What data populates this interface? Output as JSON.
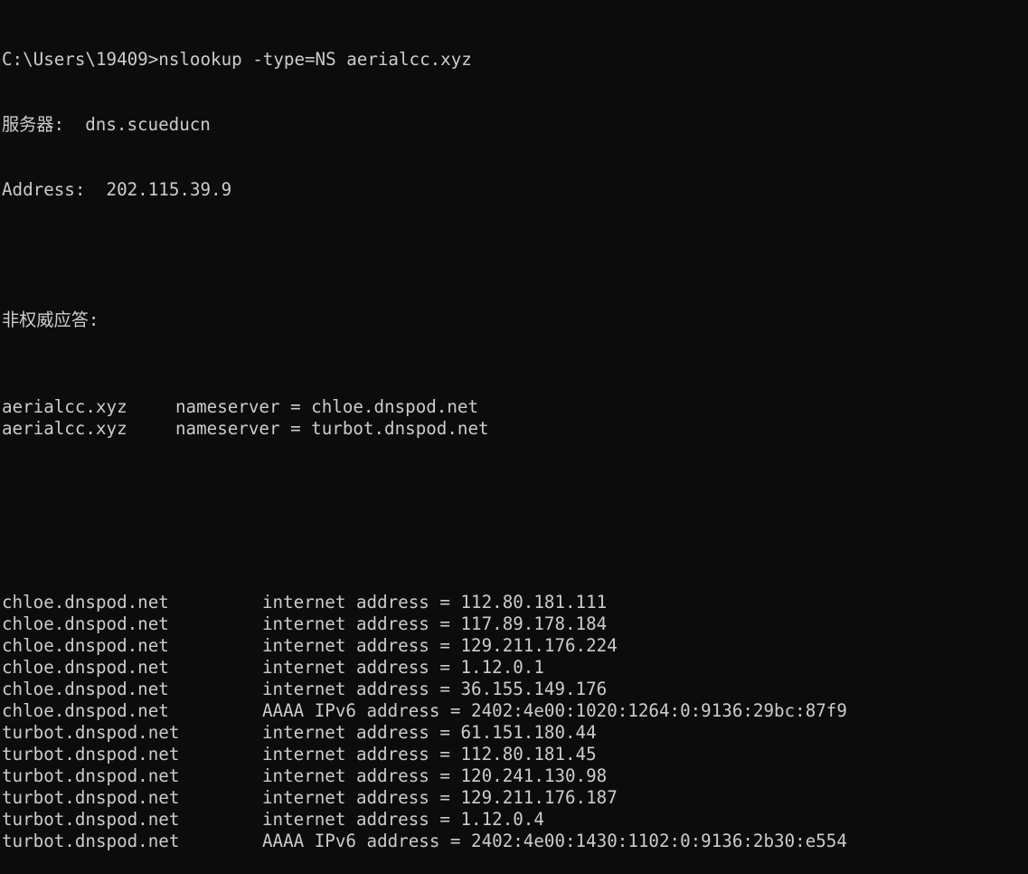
{
  "terminal": {
    "command": "C:\\Users\\19409>nslookup -type=NS aerialcc.xyz",
    "server_label": "服务器:",
    "server_value": "dns.scueducn",
    "address_label": "Address:",
    "address_value": "202.115.39.9",
    "nonauth_header": "非权威应答:",
    "ns_records": [
      {
        "domain": "aerialcc.xyz",
        "value": "nameserver = chloe.dnspod.net"
      },
      {
        "domain": "aerialcc.xyz",
        "value": "nameserver = turbot.dnspod.net"
      }
    ],
    "addr_records": [
      {
        "host": "chloe.dnspod.net",
        "value": "internet address = 112.80.181.111"
      },
      {
        "host": "chloe.dnspod.net",
        "value": "internet address = 117.89.178.184"
      },
      {
        "host": "chloe.dnspod.net",
        "value": "internet address = 129.211.176.224"
      },
      {
        "host": "chloe.dnspod.net",
        "value": "internet address = 1.12.0.1"
      },
      {
        "host": "chloe.dnspod.net",
        "value": "internet address = 36.155.149.176"
      },
      {
        "host": "chloe.dnspod.net",
        "value": "AAAA IPv6 address = 2402:4e00:1020:1264:0:9136:29bc:87f9"
      },
      {
        "host": "turbot.dnspod.net",
        "value": "internet address = 61.151.180.44"
      },
      {
        "host": "turbot.dnspod.net",
        "value": "internet address = 112.80.181.45"
      },
      {
        "host": "turbot.dnspod.net",
        "value": "internet address = 120.241.130.98"
      },
      {
        "host": "turbot.dnspod.net",
        "value": "internet address = 129.211.176.187"
      },
      {
        "host": "turbot.dnspod.net",
        "value": "internet address = 1.12.0.4"
      },
      {
        "host": "turbot.dnspod.net",
        "value": "AAAA IPv6 address = 2402:4e00:1430:1102:0:9136:2b30:e554"
      }
    ]
  },
  "colors": {
    "background": "#0c0c0c",
    "foreground": "#cccccc"
  }
}
